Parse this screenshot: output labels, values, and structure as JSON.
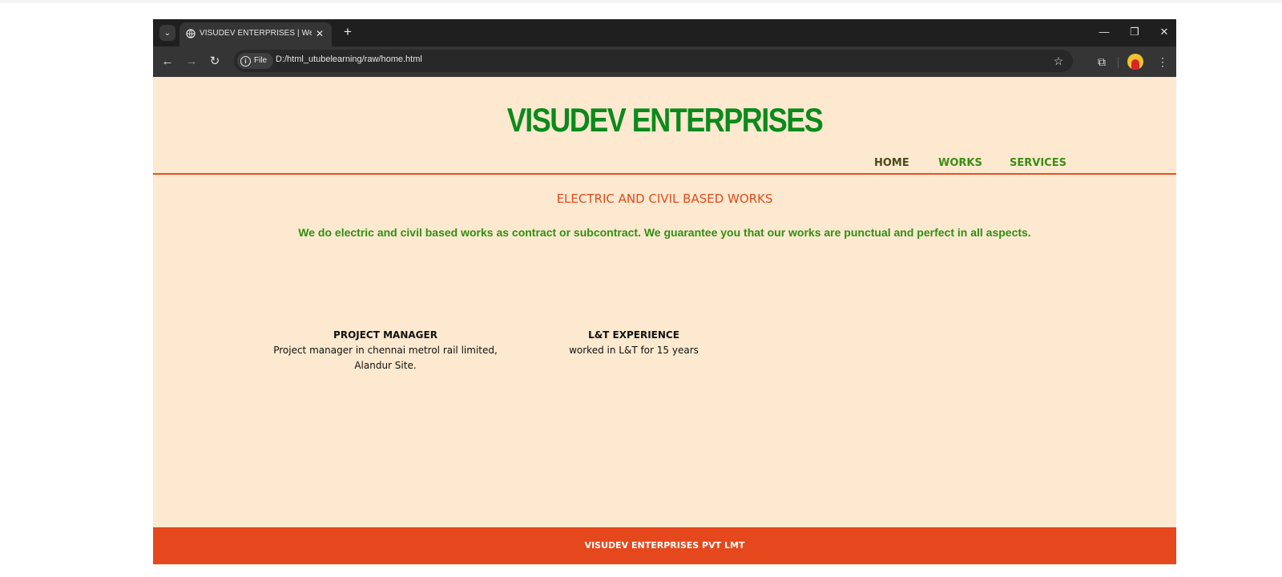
{
  "browser": {
    "tab_title": "VISUDEV ENTERPRISES | Welcome",
    "address": {
      "chip_label": "File",
      "url": "D:/html_utubelearning/raw/home.html"
    },
    "icons": [
      "chevron-down-icon",
      "globe-icon",
      "close-icon",
      "plus-icon",
      "minimize-icon",
      "restore-icon",
      "close-window-icon",
      "back-arrow-icon",
      "forward-arrow-icon",
      "reload-icon",
      "info-icon",
      "star-icon",
      "extensions-icon",
      "avatar",
      "kebab-menu-icon"
    ]
  },
  "site": {
    "title": "VISUDEV ENTERPRISES",
    "nav": [
      "HOME",
      "WORKS",
      "SERVICES"
    ],
    "heading": "ELECTRIC AND CIVIL BASED WORKS",
    "tagline": "We do electric and civil based works as contract or subcontract. We guarantee you that our works are punctual and perfect in all aspects.",
    "cards": [
      {
        "title": "PROJECT MANAGER",
        "text": "Project manager in chennai metrol rail limited, Alandur Site."
      },
      {
        "title": "L&T EXPERIENCE",
        "text": "worked in L&T for 15 years"
      }
    ],
    "footer": "VISUDEV ENTERPRISES PVT LMT"
  },
  "colors": {
    "page_bg": "#fde9cf",
    "title_green": "#0b8a1c",
    "nav_green": "#3c8d14",
    "accent_orange": "#e5481d",
    "browser_dark": "#1f1f1f"
  }
}
